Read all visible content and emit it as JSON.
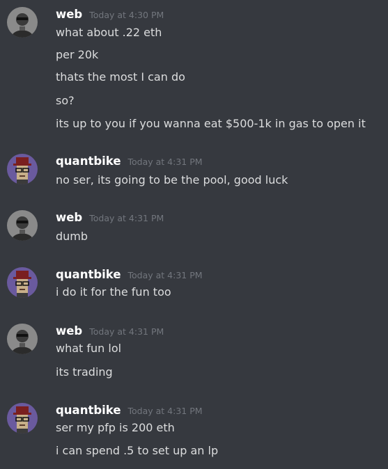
{
  "messages": [
    {
      "author": "web",
      "timestamp": "Today at 4:30 PM",
      "avatar": "web-avatar",
      "lines": [
        "what about .22 eth",
        "per 20k",
        "thats the most I can do",
        "so?",
        "its up to you if you wanna eat $500-1k in gas to open it"
      ]
    },
    {
      "author": "quantbike",
      "timestamp": "Today at 4:31 PM",
      "avatar": "quantbike-avatar",
      "lines": [
        "no ser, its going to be the pool, good luck"
      ]
    },
    {
      "author": "web",
      "timestamp": "Today at 4:31 PM",
      "avatar": "web-avatar",
      "lines": [
        "dumb"
      ]
    },
    {
      "author": "quantbike",
      "timestamp": "Today at 4:31 PM",
      "avatar": "quantbike-avatar",
      "lines": [
        "i do it for the fun too"
      ]
    },
    {
      "author": "web",
      "timestamp": "Today at 4:31 PM",
      "avatar": "web-avatar",
      "lines": [
        "what fun lol",
        "its trading"
      ]
    },
    {
      "author": "quantbike",
      "timestamp": "Today at 4:31 PM",
      "avatar": "quantbike-avatar",
      "lines": [
        "ser my pfp is 200 eth",
        "i can spend .5 to set up an lp"
      ]
    }
  ],
  "colors": {
    "background": "#36393f",
    "username": "#ffffff",
    "timestamp": "#72767d",
    "message_text": "#dcddde",
    "quantbike_avatar_bg": "#6a5a9e"
  }
}
